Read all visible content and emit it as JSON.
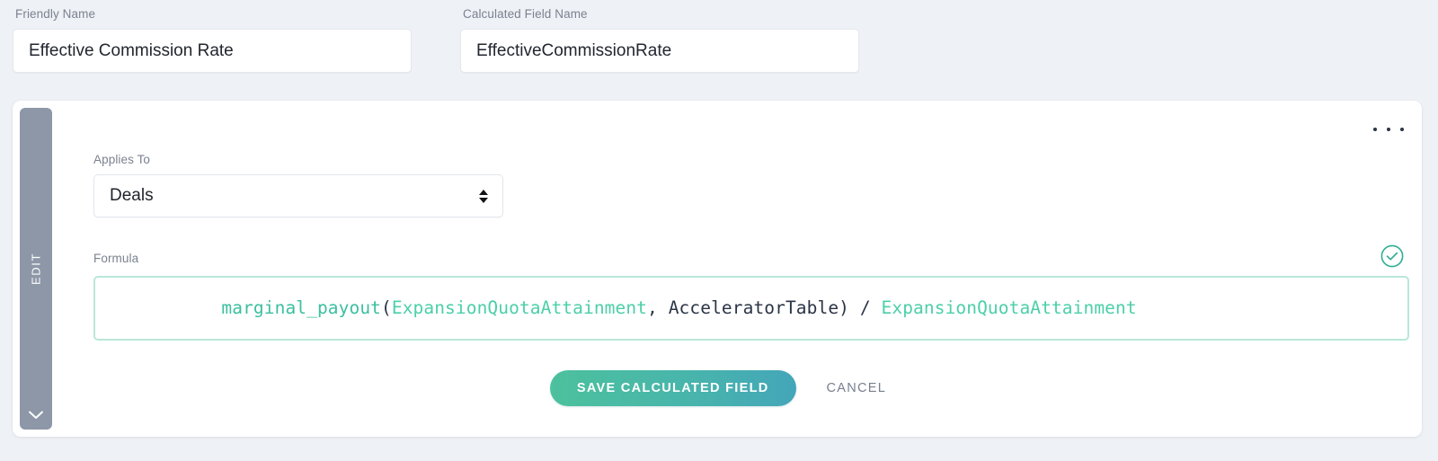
{
  "fields": {
    "friendly": {
      "label": "Friendly Name",
      "value": "Effective Commission Rate",
      "placeholder": "Friendly Name"
    },
    "calculated": {
      "label": "Calculated Field Name",
      "value": "EffectiveCommissionRate",
      "placeholder": "Calculated Field Name"
    }
  },
  "card": {
    "edit_tab_label": "EDIT",
    "edit_tab_chevron_icon": "chevron-down-icon",
    "overflow_menu_icon": "ellipsis-horizontal-icon",
    "applies_to": {
      "label": "Applies To",
      "selected": "Deals",
      "options": [
        "Deals"
      ]
    },
    "formula": {
      "label": "Formula",
      "valid_icon": "check-circle-icon",
      "text": "marginal_payout(ExpansionQuotaAttainment, AcceleratorTable) / ExpansionQuotaAttainment",
      "tokens": [
        {
          "text": "marginal_payout",
          "kind": "fn"
        },
        {
          "text": "(",
          "kind": "plain"
        },
        {
          "text": "ExpansionQuotaAttainment",
          "kind": "var"
        },
        {
          "text": ", ",
          "kind": "plain"
        },
        {
          "text": "AcceleratorTable) / ",
          "kind": "plain"
        },
        {
          "text": "ExpansionQuotaAttainment",
          "kind": "var"
        }
      ]
    },
    "actions": {
      "save_label": "SAVE CALCULATED FIELD",
      "cancel_label": "CANCEL"
    }
  },
  "colors": {
    "page_background": "#eef1f5",
    "card_background": "#ffffff",
    "edit_tab": "#8d97a8",
    "accent_teal": "#3cbfa0",
    "formula_border": "#b9e7da",
    "save_gradient_start": "#4cc19d",
    "save_gradient_end": "#44a6b9",
    "label_text": "#7b8290",
    "body_text": "#22262e"
  }
}
